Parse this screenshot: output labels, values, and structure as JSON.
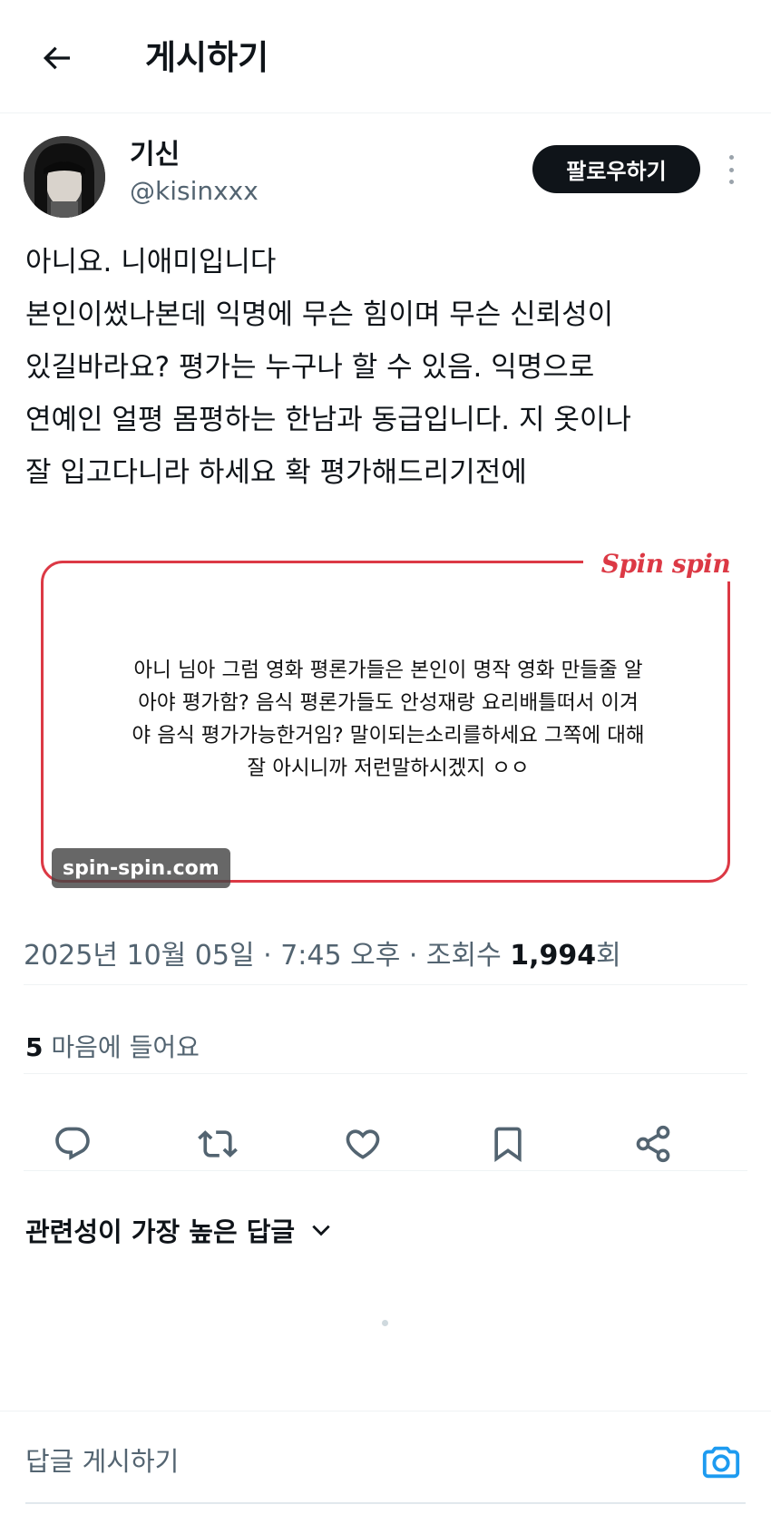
{
  "header": {
    "title": "게시하기"
  },
  "author": {
    "display_name": "기신",
    "handle": "@kisinxxx"
  },
  "follow_label": "팔로우하기",
  "post": {
    "text": "아니요. 니애미입니다\n본인이썼나본데 익명에 무슨 힘이며 무슨 신뢰성이\n있길바라요? 평가는 누구나 할 수 있음. 익명으로\n연예인 얼평 몸평하는 한남과 동급입니다. 지 옷이나\n잘 입고다니라 하세요 확 평가해드리기전에"
  },
  "quote": {
    "brand": "Spin spin",
    "text": "아니 님아 그럼 영화 평론가들은 본인이 명작 영화 만들줄 알\n아야 평가함? 음식 평론가들도 안성재랑 요리배틀떠서 이겨\n야 음식 평가가능한거임? 말이되는소리를하세요 그쪽에 대해\n잘 아시니까 저런말하시겠지 ㅇㅇ",
    "watermark": "spin-spin.com"
  },
  "meta": {
    "date": "2025년 10월 05일",
    "time": "7:45 오후",
    "views_label": "조회수",
    "views": "1,994",
    "views_unit": "회"
  },
  "likes": {
    "count": "5",
    "label": "마음에 들어요"
  },
  "actions": [
    "reply-icon",
    "retweet-icon",
    "heart-icon",
    "bookmark-icon",
    "share-icon"
  ],
  "replies_sort": {
    "label": "관련성이 가장 높은 답글"
  },
  "reply_input": {
    "placeholder": "답글 게시하기"
  },
  "colors": {
    "brand_red": "#dc3945",
    "text_primary": "#0f1419",
    "text_secondary": "#536471",
    "accent_blue": "#1d9bf0"
  }
}
